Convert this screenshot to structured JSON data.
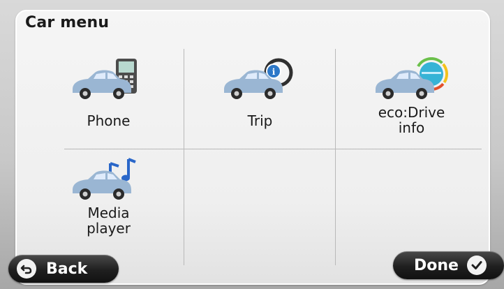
{
  "screen": {
    "title": "Car menu"
  },
  "menu": {
    "items": [
      {
        "label": "Phone",
        "icon": "car-phone-icon"
      },
      {
        "label": "Trip",
        "icon": "car-trip-icon"
      },
      {
        "label": "eco:Drive info",
        "label_lines": [
          "eco:Drive",
          "info"
        ],
        "icon": "car-eco-drive-icon"
      },
      {
        "label": "Media player",
        "label_lines": [
          "Media",
          "player"
        ],
        "icon": "car-media-player-icon"
      }
    ]
  },
  "buttons": {
    "back": {
      "label": "Back",
      "icon": "back-arrow-icon"
    },
    "done": {
      "label": "Done",
      "icon": "checkmark-icon"
    }
  },
  "colors": {
    "panel_bg": "#f2f2f2",
    "car_body": "#9ab6d3",
    "pill_bg": "#1f1f1f",
    "info_badge": "#2d78c8",
    "music_note": "#2a67c9"
  }
}
